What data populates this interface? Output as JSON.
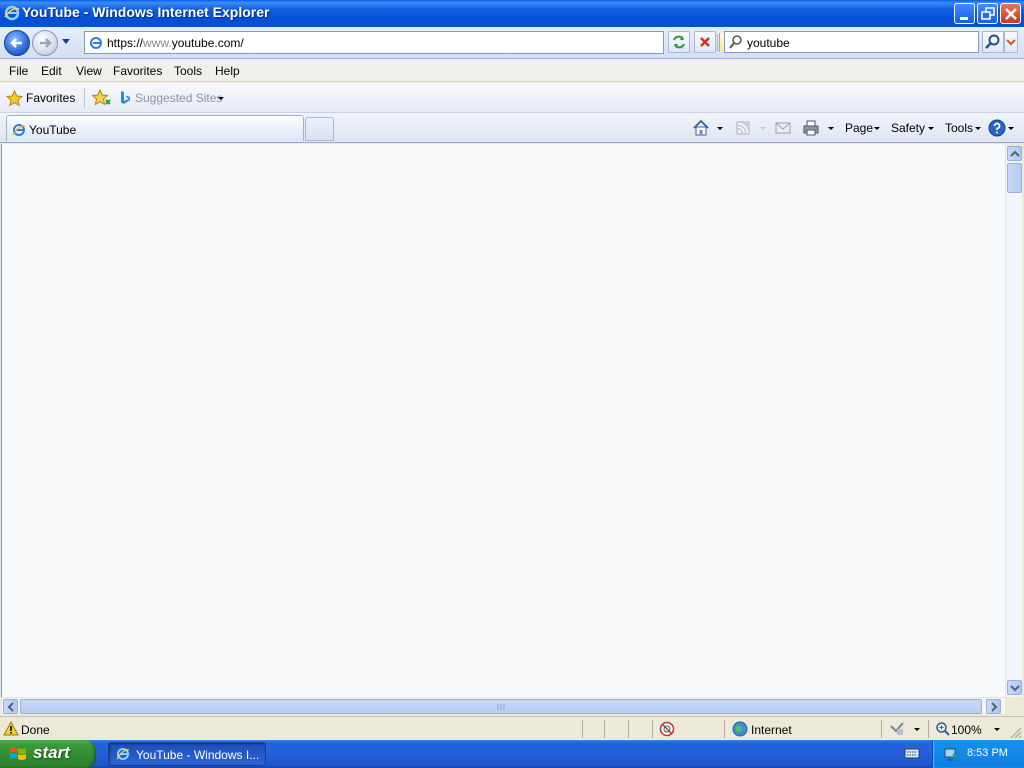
{
  "window": {
    "title": "YouTube - Windows Internet Explorer"
  },
  "navbar": {
    "url_prefix": "https://",
    "url_www": "www.",
    "url_domain": "youtube.com/",
    "search_value": "youtube"
  },
  "menubar": {
    "items": [
      "File",
      "Edit",
      "View",
      "Favorites",
      "Tools",
      "Help"
    ]
  },
  "favorites_bar": {
    "favorites_label": "Favorites",
    "suggested_label": "Suggested Sites"
  },
  "tabs": {
    "active_label": "YouTube"
  },
  "command_bar": {
    "page_label": "Page",
    "safety_label": "Safety",
    "tools_label": "Tools"
  },
  "status_bar": {
    "status_text": "Done",
    "zone_text": "Internet",
    "zoom_text": "100%"
  },
  "taskbar": {
    "start_label": "start",
    "task_label": "YouTube - Windows I...",
    "clock": "8:53 PM"
  },
  "colors": {
    "titlebar": "#0550d8",
    "taskbar": "#245edb",
    "start": "#3c9c3c",
    "content_bg": "#f8f9fa"
  }
}
